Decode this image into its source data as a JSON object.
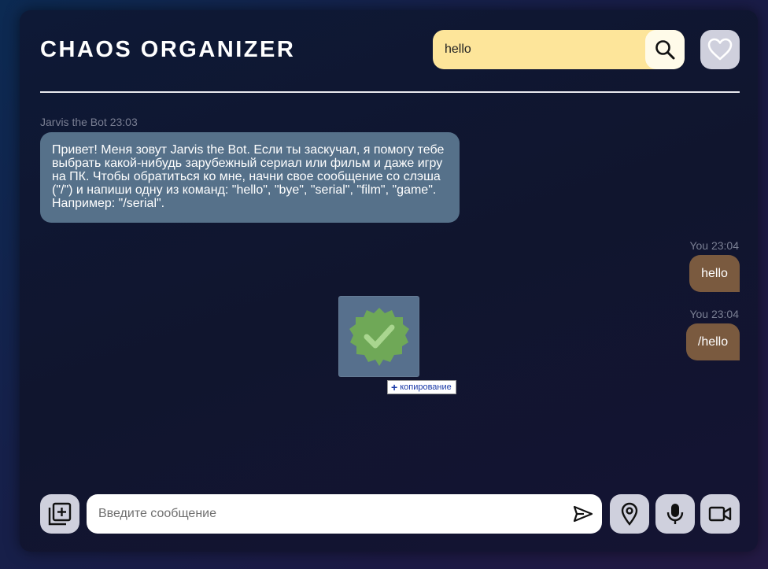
{
  "header": {
    "title": "CHAOS ORGANIZER",
    "search_value": "hello"
  },
  "messages": [
    {
      "author": "Jarvis the Bot 23:03",
      "text": "Привет! Меня зовут Jarvis the Bot. Если ты заскучал, я помогу тебе выбрать какой-нибудь зарубежный сериал или фильм и даже игру на ПК. Чтобы обратиться ко мне, начни свое сообщение со слэша (\"/\") и напиши одну из команд: \"hello\", \"bye\", \"serial\", \"film\", \"game\". Например: \"/serial\"."
    },
    {
      "author": "You 23:04",
      "text": "hello"
    },
    {
      "author": "You 23:04",
      "text": "/hello"
    }
  ],
  "drag": {
    "tooltip": "копирование"
  },
  "composer": {
    "placeholder": "Введите сообщение"
  },
  "colors": {
    "search_bg": "#fde59a",
    "bot_bubble": "#56718a",
    "user_bubble": "#7a5a3f",
    "button_bg": "#cfd0dd"
  },
  "icons": {
    "search": "search-icon",
    "favorites": "heart-icon",
    "attach": "add-files-icon",
    "send": "send-icon",
    "location": "location-pin-icon",
    "audio": "microphone-icon",
    "video": "video-camera-icon",
    "drag_file": "verified-badge-icon"
  }
}
